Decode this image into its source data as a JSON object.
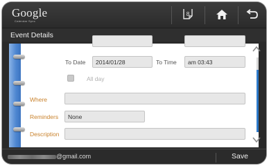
{
  "app": {
    "logo_text": "Google",
    "logo_subtext": "Calendar Sync"
  },
  "toolbar": {
    "icons": [
      "calendar-icon",
      "home-icon",
      "back-icon"
    ],
    "calendar_glyph_text": "8"
  },
  "header": {
    "title": "Event Details"
  },
  "form": {
    "to_date_label": "To Date",
    "to_date_value": "2014/01/28",
    "to_time_label": "To Time",
    "to_time_value": "am 03:43",
    "all_day_label": "All day",
    "all_day_checked": false,
    "where_label": "Where",
    "where_value": "",
    "reminders_label": "Reminders",
    "reminders_value": "None",
    "description_label": "Description",
    "description_value": ""
  },
  "footer": {
    "email_suffix": "@gmail.com",
    "save_label": "Save"
  },
  "colors": {
    "accent_blue": "#2d79c9",
    "label_orange": "#c9822c",
    "bar_dark": "#2b2b2b"
  }
}
